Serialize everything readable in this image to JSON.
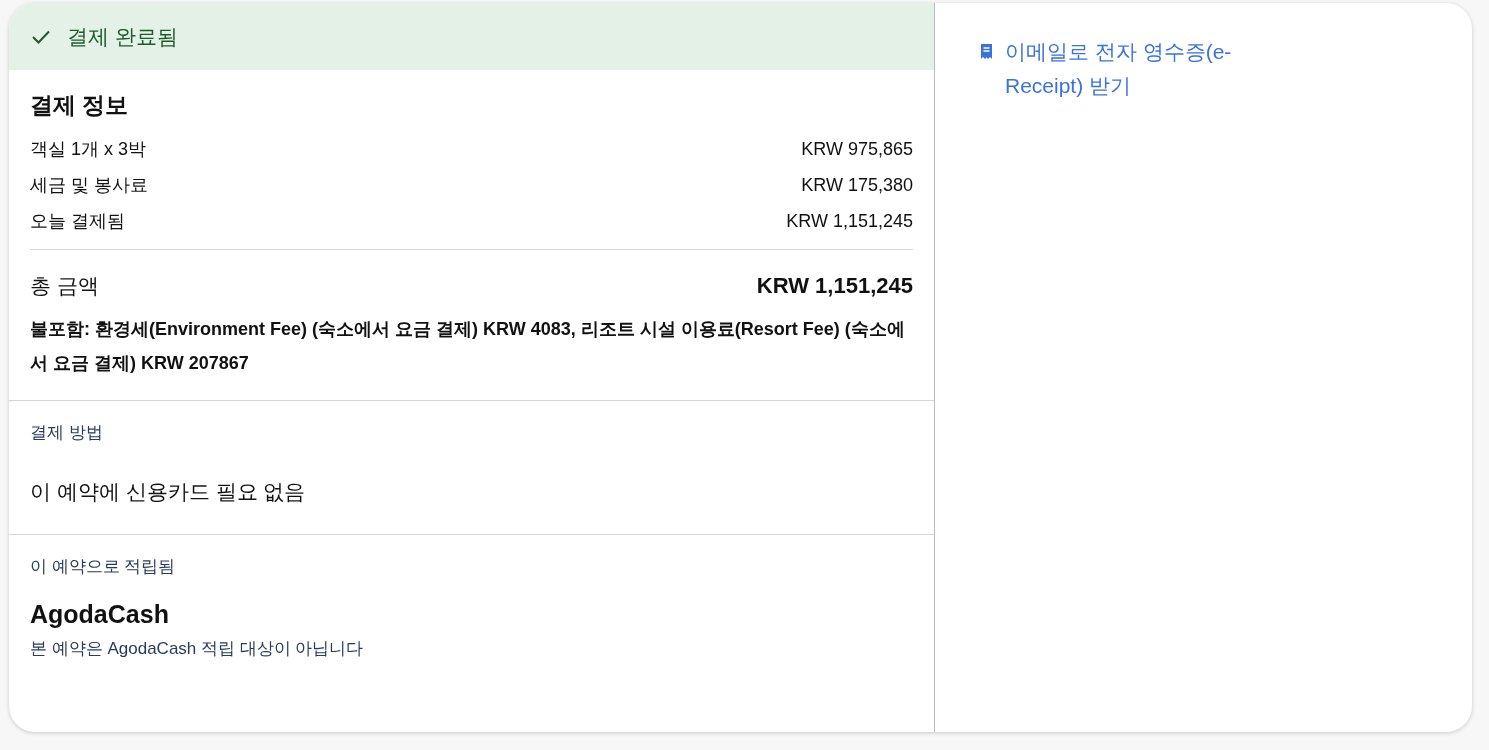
{
  "status": {
    "label": "결제 완료됨"
  },
  "payment_info": {
    "title": "결제 정보",
    "lines": [
      {
        "label": "객실 1개 x 3박",
        "amount": "KRW 975,865"
      },
      {
        "label": "세금 및 봉사료",
        "amount": "KRW 175,380"
      },
      {
        "label": "오늘 결제됨",
        "amount": "KRW 1,151,245"
      }
    ],
    "total": {
      "label": "총 금액",
      "amount": "KRW 1,151,245"
    },
    "excluded_note": "불포함: 환경세(Environment Fee) (숙소에서 요금 결제) KRW 4083, 리조트 시설 이용료(Resort Fee) (숙소에서 요금 결제) KRW 207867"
  },
  "payment_method": {
    "title": "결제 방법",
    "value": "이 예약에 신용카드 필요 없음"
  },
  "earned": {
    "title": "이 예약으로 적립됨",
    "program": "AgodaCash",
    "note": "본 예약은 AgodaCash 적립 대상이 아닙니다"
  },
  "receipt_link": {
    "label": "이메일로 전자 영수증(e-Receipt) 받기"
  }
}
